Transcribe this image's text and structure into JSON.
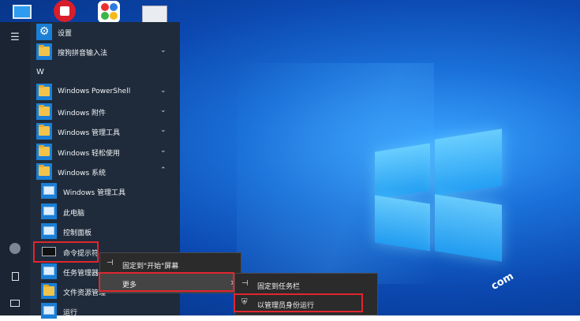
{
  "desktop": {
    "icons": [
      {
        "name": "this-pc-desktop-icon"
      },
      {
        "name": "bank-desktop-icon"
      },
      {
        "name": "app-desktop-icon"
      },
      {
        "name": "settings-desktop-icon"
      }
    ],
    "watermark": "com"
  },
  "start_menu": {
    "rail": {
      "hamburger": "☰",
      "user": "👤",
      "documents": "📄",
      "pictures": "🖼"
    },
    "items": [
      {
        "label": "设置",
        "icon": "gear-icon"
      },
      {
        "label": "搜狗拼音输入法",
        "icon": "folder-icon",
        "chevron": "⌄"
      },
      {
        "letter": "W"
      },
      {
        "label": "Windows PowerShell",
        "icon": "folder-icon",
        "chevron": "⌄"
      },
      {
        "label": "Windows 附件",
        "icon": "folder-icon",
        "chevron": "⌄"
      },
      {
        "label": "Windows 管理工具",
        "icon": "folder-icon",
        "chevron": "⌄"
      },
      {
        "label": "Windows 轻松使用",
        "icon": "folder-icon",
        "chevron": "⌄"
      },
      {
        "label": "Windows 系统",
        "icon": "folder-icon",
        "chevron": "⌃"
      }
    ],
    "sub_items": [
      {
        "label": "Windows 管理工具"
      },
      {
        "label": "此电脑"
      },
      {
        "label": "控制面板"
      },
      {
        "label": "命令提示符"
      },
      {
        "label": "任务管理器"
      },
      {
        "label": "文件资源管理"
      },
      {
        "label": "运行"
      }
    ]
  },
  "context_menu": {
    "items": [
      {
        "icon": "⊣",
        "label": "固定到\"开始\"屏幕"
      },
      {
        "icon": "",
        "label": "更多",
        "arrow": "›"
      }
    ]
  },
  "more_menu": {
    "items": [
      {
        "icon": "⊣",
        "label": "固定到任务栏"
      },
      {
        "icon": "⛨",
        "label": "以管理员身份运行"
      }
    ]
  },
  "colors": {
    "accent": "#1a7fd6",
    "highlight": "#e0262e"
  }
}
